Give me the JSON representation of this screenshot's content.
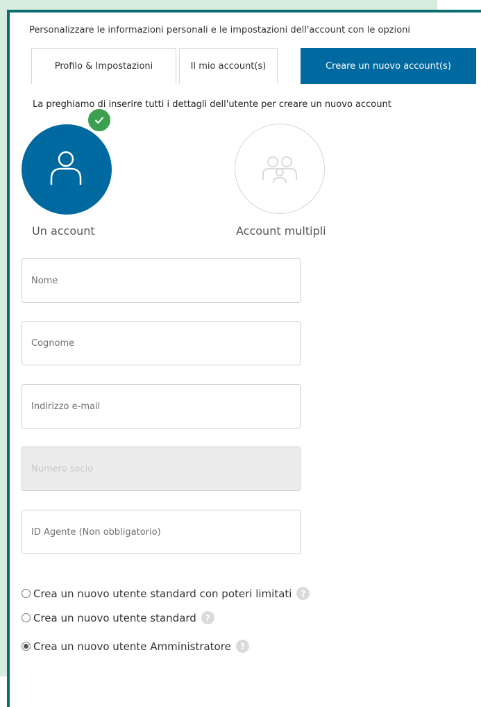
{
  "intro_text": "Personalizzare le informazioni personali e le impostazioni dell'account con le opzioni",
  "tabs": [
    {
      "label": "Profilo & Impostazioni",
      "active": false
    },
    {
      "label": "Il mio account(s)",
      "active": false
    },
    {
      "label": "Creare un nuovo account(s)",
      "active": true
    }
  ],
  "instruction": "La preghiamo di inserire tutti i dettagli dell'utente per creare un nuovo account",
  "account_types": [
    {
      "label": "Un account",
      "icon": "single-user-icon",
      "selected": true
    },
    {
      "label": "Account multipli",
      "icon": "multiple-users-icon",
      "selected": false
    }
  ],
  "fields": {
    "first_name": {
      "placeholder": "Nome",
      "value": ""
    },
    "last_name": {
      "placeholder": "Cognome",
      "value": ""
    },
    "email": {
      "placeholder": "Indirizzo e-mail",
      "value": ""
    },
    "member_number": {
      "placeholder": "Numero socio",
      "value": "",
      "disabled": true
    },
    "agent_id": {
      "placeholder": "ID Agente (Non obbligatorio)",
      "value": ""
    }
  },
  "user_roles": [
    {
      "label": "Crea un nuovo utente standard con poteri limitati",
      "checked": false,
      "help_icon": "?"
    },
    {
      "label": "Crea un nuovo utente standard",
      "checked": false,
      "help_icon": "?"
    },
    {
      "label": "Crea un nuovo utente Amministratore",
      "checked": true,
      "help_icon": "?"
    }
  ],
  "colors": {
    "primary": "#00699f",
    "frame_border": "#0a6e71",
    "background_mint": "#d6ecdc",
    "check_green": "#3b9f50"
  }
}
